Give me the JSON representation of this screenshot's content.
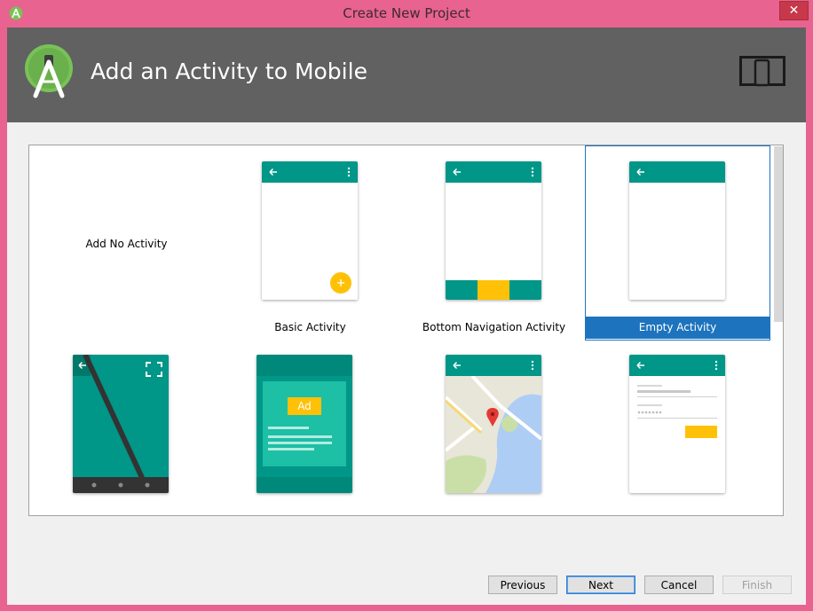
{
  "window": {
    "title": "Create New Project",
    "close_glyph": "✕"
  },
  "header": {
    "title": "Add an Activity to Mobile"
  },
  "activities": [
    {
      "label": "Add No Activity",
      "selected": false
    },
    {
      "label": "Basic Activity",
      "selected": false
    },
    {
      "label": "Bottom Navigation Activity",
      "selected": false
    },
    {
      "label": "Empty Activity",
      "selected": true
    },
    {
      "label": "",
      "selected": false
    },
    {
      "label": "",
      "selected": false,
      "ad_text": "Ad"
    },
    {
      "label": "",
      "selected": false
    },
    {
      "label": "",
      "selected": false
    }
  ],
  "buttons": {
    "previous": "Previous",
    "next": "Next",
    "cancel": "Cancel",
    "finish": "Finish"
  },
  "colors": {
    "accent": "#009688",
    "selection": "#1e73be",
    "fab": "#ffc107",
    "header": "#616161"
  }
}
